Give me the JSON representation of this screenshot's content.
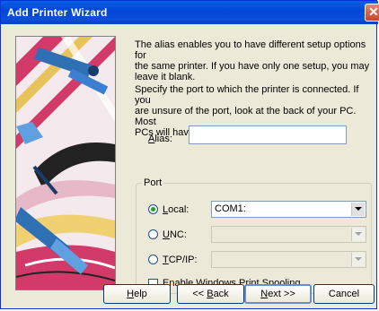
{
  "window": {
    "title": "Add Printer Wizard"
  },
  "content": {
    "intro_para1_lines": [
      "The alias enables you to have different setup options for",
      "the same printer.  If you have only one setup, you may",
      "leave it blank."
    ],
    "intro_para2_lines": [
      "Specify the port to which the printer is connected.  If you",
      "are unsure of the port, look at the back of your PC.  Most",
      "PCs will have the ports labeled."
    ],
    "alias": {
      "label_mnemonic": "A",
      "label_rest": "lias:",
      "value": ""
    },
    "port_group_label": "Port",
    "local": {
      "label_mnemonic": "L",
      "label_rest": "ocal:",
      "selected": true,
      "combo_value": "COM1:"
    },
    "unc": {
      "label_mnemonic": "U",
      "label_rest": "NC:",
      "selected": false,
      "combo_value": ""
    },
    "tcpip": {
      "label_mnemonic": "T",
      "label_rest": "CP/IP:",
      "selected": false,
      "combo_value": ""
    },
    "spooling": {
      "label": "Enable Windows Print Spooling",
      "checked": false
    }
  },
  "buttons": {
    "help": {
      "mnemonic": "H",
      "rest": "elp"
    },
    "back": {
      "prefix": "<< ",
      "mnemonic": "B",
      "rest": "ack"
    },
    "next": {
      "mnemonic": "N",
      "rest": "ext >>"
    },
    "cancel": {
      "label": "Cancel"
    }
  },
  "colors": {
    "titlebar": "#0a4fd9",
    "window_face": "#ece9d8",
    "close_button": "#c8442a",
    "radio_dot": "#21a121"
  }
}
